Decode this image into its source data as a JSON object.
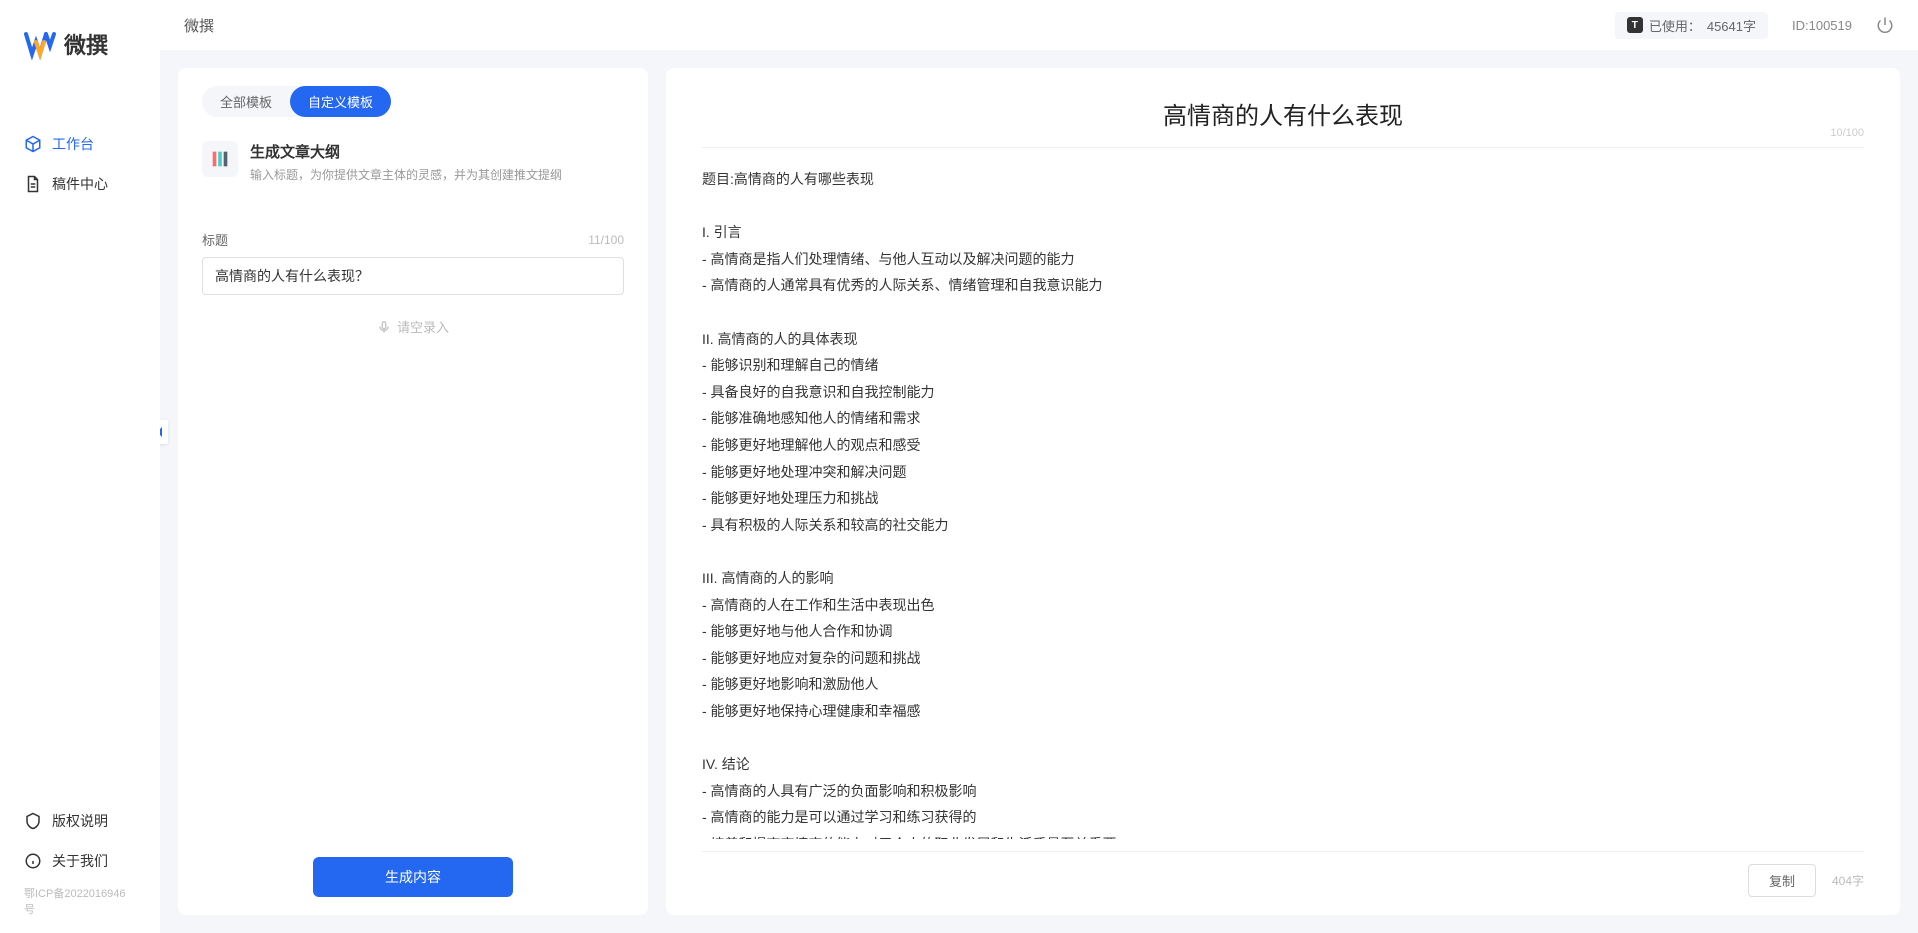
{
  "app": {
    "name": "微撰",
    "logo_colors": [
      "#2468f2",
      "#ffa726",
      "#2468f2"
    ]
  },
  "topbar": {
    "title": "微撰",
    "usage_prefix": "已使用：",
    "usage_value": "45641字",
    "id_label": "ID:100519"
  },
  "sidebar": {
    "items": [
      {
        "label": "工作台",
        "active": true,
        "icon": "cube"
      },
      {
        "label": "稿件中心",
        "active": false,
        "icon": "document"
      }
    ],
    "bottom": [
      {
        "label": "版权说明",
        "icon": "shield"
      },
      {
        "label": "关于我们",
        "icon": "info"
      }
    ],
    "icp": "鄂ICP备2022016946号"
  },
  "left_panel": {
    "tabs": [
      {
        "label": "全部模板",
        "active": false
      },
      {
        "label": "自定义模板",
        "active": true
      }
    ],
    "template": {
      "title": "生成文章大纲",
      "desc": "输入标题，为你提供文章主体的灵感，并为其创建推文提纲"
    },
    "form": {
      "label": "标题",
      "count": "11/100",
      "value": "高情商的人有什么表现？",
      "voice_hint": "请空录入"
    },
    "generate_btn": "生成内容"
  },
  "output": {
    "title": "高情商的人有什么表现",
    "title_count": "10/100",
    "body": "题目:高情商的人有哪些表现\n\nI. 引言\n- 高情商是指人们处理情绪、与他人互动以及解决问题的能力\n- 高情商的人通常具有优秀的人际关系、情绪管理和自我意识能力\n\nII. 高情商的人的具体表现\n- 能够识别和理解自己的情绪\n- 具备良好的自我意识和自我控制能力\n- 能够准确地感知他人的情绪和需求\n- 能够更好地理解他人的观点和感受\n- 能够更好地处理冲突和解决问题\n- 能够更好地处理压力和挑战\n- 具有积极的人际关系和较高的社交能力\n\nIII. 高情商的人的影响\n- 高情商的人在工作和生活中表现出色\n- 能够更好地与他人合作和协调\n- 能够更好地应对复杂的问题和挑战\n- 能够更好地影响和激励他人\n- 能够更好地保持心理健康和幸福感\n\nIV. 结论\n- 高情商的人具有广泛的负面影响和积极影响\n- 高情商的能力是可以通过学习和练习获得的\n- 培养和提高高情商的能力对于个人的职业发展和生活质量至关重要。",
    "copy_btn": "复制",
    "char_count": "404字"
  }
}
